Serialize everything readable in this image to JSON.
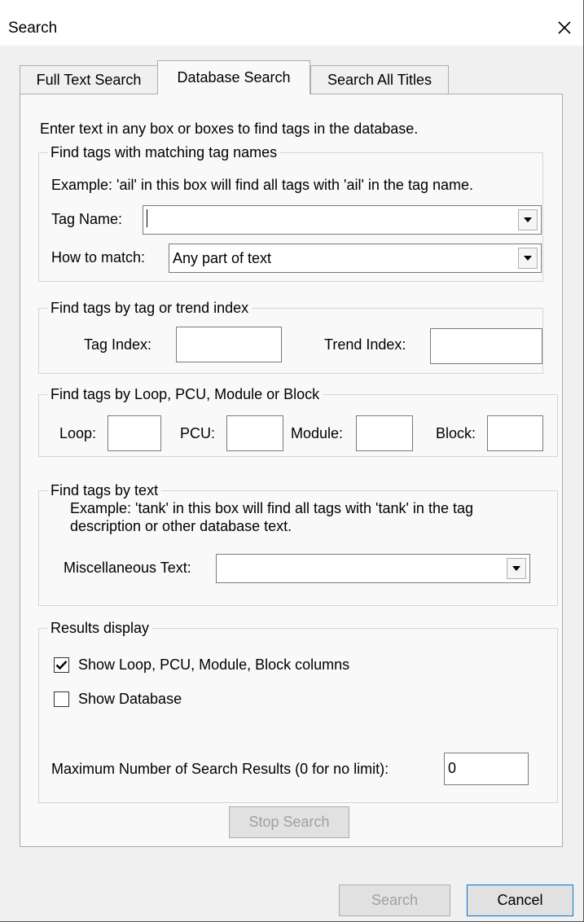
{
  "window": {
    "title": "Search"
  },
  "tabs": [
    {
      "label": "Full Text Search",
      "active": false
    },
    {
      "label": "Database Search",
      "active": true
    },
    {
      "label": "Search All Titles",
      "active": false
    }
  ],
  "intro": "Enter text in any box or boxes to find tags in the database.",
  "tag_names_group": {
    "legend": "Find tags with matching tag names",
    "example": "Example:  'ail' in this box will find all tags with 'ail' in the tag name.",
    "tag_name_label": "Tag Name:",
    "tag_name_value": "",
    "how_to_match_label": "How to match:",
    "how_to_match_value": "Any part of text"
  },
  "index_group": {
    "legend": "Find tags by tag or trend index",
    "tag_index_label": "Tag Index:",
    "trend_index_label": "Trend Index:"
  },
  "loop_group": {
    "legend": "Find tags by Loop, PCU, Module or Block",
    "loop_label": "Loop:",
    "pcu_label": "PCU:",
    "module_label": "Module:",
    "block_label": "Block:"
  },
  "text_group": {
    "legend": "Find tags by text",
    "example_line1": "Example:  'tank' in this box will find all tags with 'tank' in the tag",
    "example_line2": "description or other database text.",
    "misc_label": "Miscellaneous Text:",
    "misc_value": ""
  },
  "results_group": {
    "legend": "Results display",
    "show_columns_label": "Show Loop, PCU, Module, Block columns",
    "show_columns_checked": true,
    "show_database_label": "Show Database",
    "show_database_checked": false,
    "max_results_label": "Maximum Number of Search Results (0 for no limit):",
    "max_results_value": "0"
  },
  "buttons": {
    "stop_search": "Stop Search",
    "search": "Search",
    "cancel": "Cancel"
  }
}
